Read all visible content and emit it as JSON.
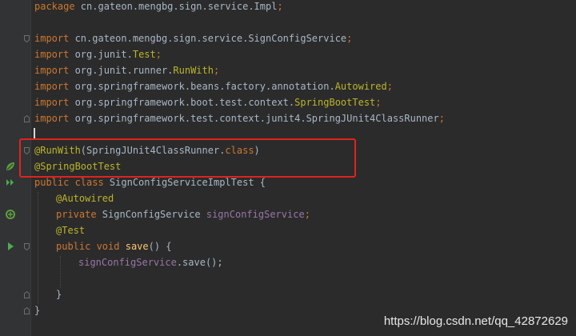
{
  "code_lines": [
    {
      "t1": "package",
      "t2": " cn.gateon.mengbg.sign.service.Impl",
      "t3": ";"
    },
    {
      "t1": "import",
      "t2": " cn.gateon.mengbg.sign.service.SignConfigService",
      "t3": ";"
    },
    {
      "t1": "import",
      "t2": " org.junit.",
      "t3": "Test",
      "t4": ";"
    },
    {
      "t1": "import",
      "t2": " org.junit.runner.",
      "t3": "RunWith",
      "t4": ";"
    },
    {
      "t1": "import",
      "t2": " org.springframework.beans.factory.annotation.",
      "t3": "Autowired",
      "t4": ";"
    },
    {
      "t1": "import",
      "t2": " org.springframework.boot.test.context.",
      "t3": "SpringBootTest",
      "t4": ";"
    },
    {
      "t1": "import",
      "t2": " org.springframework.test.context.junit4.SpringJUnit4ClassRunner",
      "t3": ";"
    },
    {
      "t1": "@RunWith",
      "t2": "(SpringJUnit4ClassRunner.",
      "t3": "class",
      "t4": ")"
    },
    {
      "t1": "@SpringBootTest"
    },
    {
      "t1": "public class",
      "t2": " SignConfigServiceImplTest {"
    },
    {
      "t1": "@Autowired"
    },
    {
      "t1": "private",
      "t2": " SignConfigService ",
      "t3": "signConfigService",
      "t4": ";"
    },
    {
      "t1": "@Test"
    },
    {
      "t1": "public void",
      "t2": " ",
      "t3": "save",
      "t4": "() {"
    },
    {
      "t1": "signConfigService",
      "t2": ".save();"
    },
    {
      "t1": "}"
    },
    {
      "t1": "}"
    }
  ],
  "watermark": "https://blog.csdn.net/qq_42872629",
  "colors": {
    "keyword": "#cc7832",
    "annotation": "#bbb529",
    "field": "#9876aa",
    "method": "#ffc66d",
    "text": "#a9b7c6",
    "highlight_box": "#e0231f"
  },
  "gutter_icons": [
    "spring-bean-icon",
    "run-test-class-icon",
    "spring-autowired-icon",
    "run-test-method-icon"
  ]
}
